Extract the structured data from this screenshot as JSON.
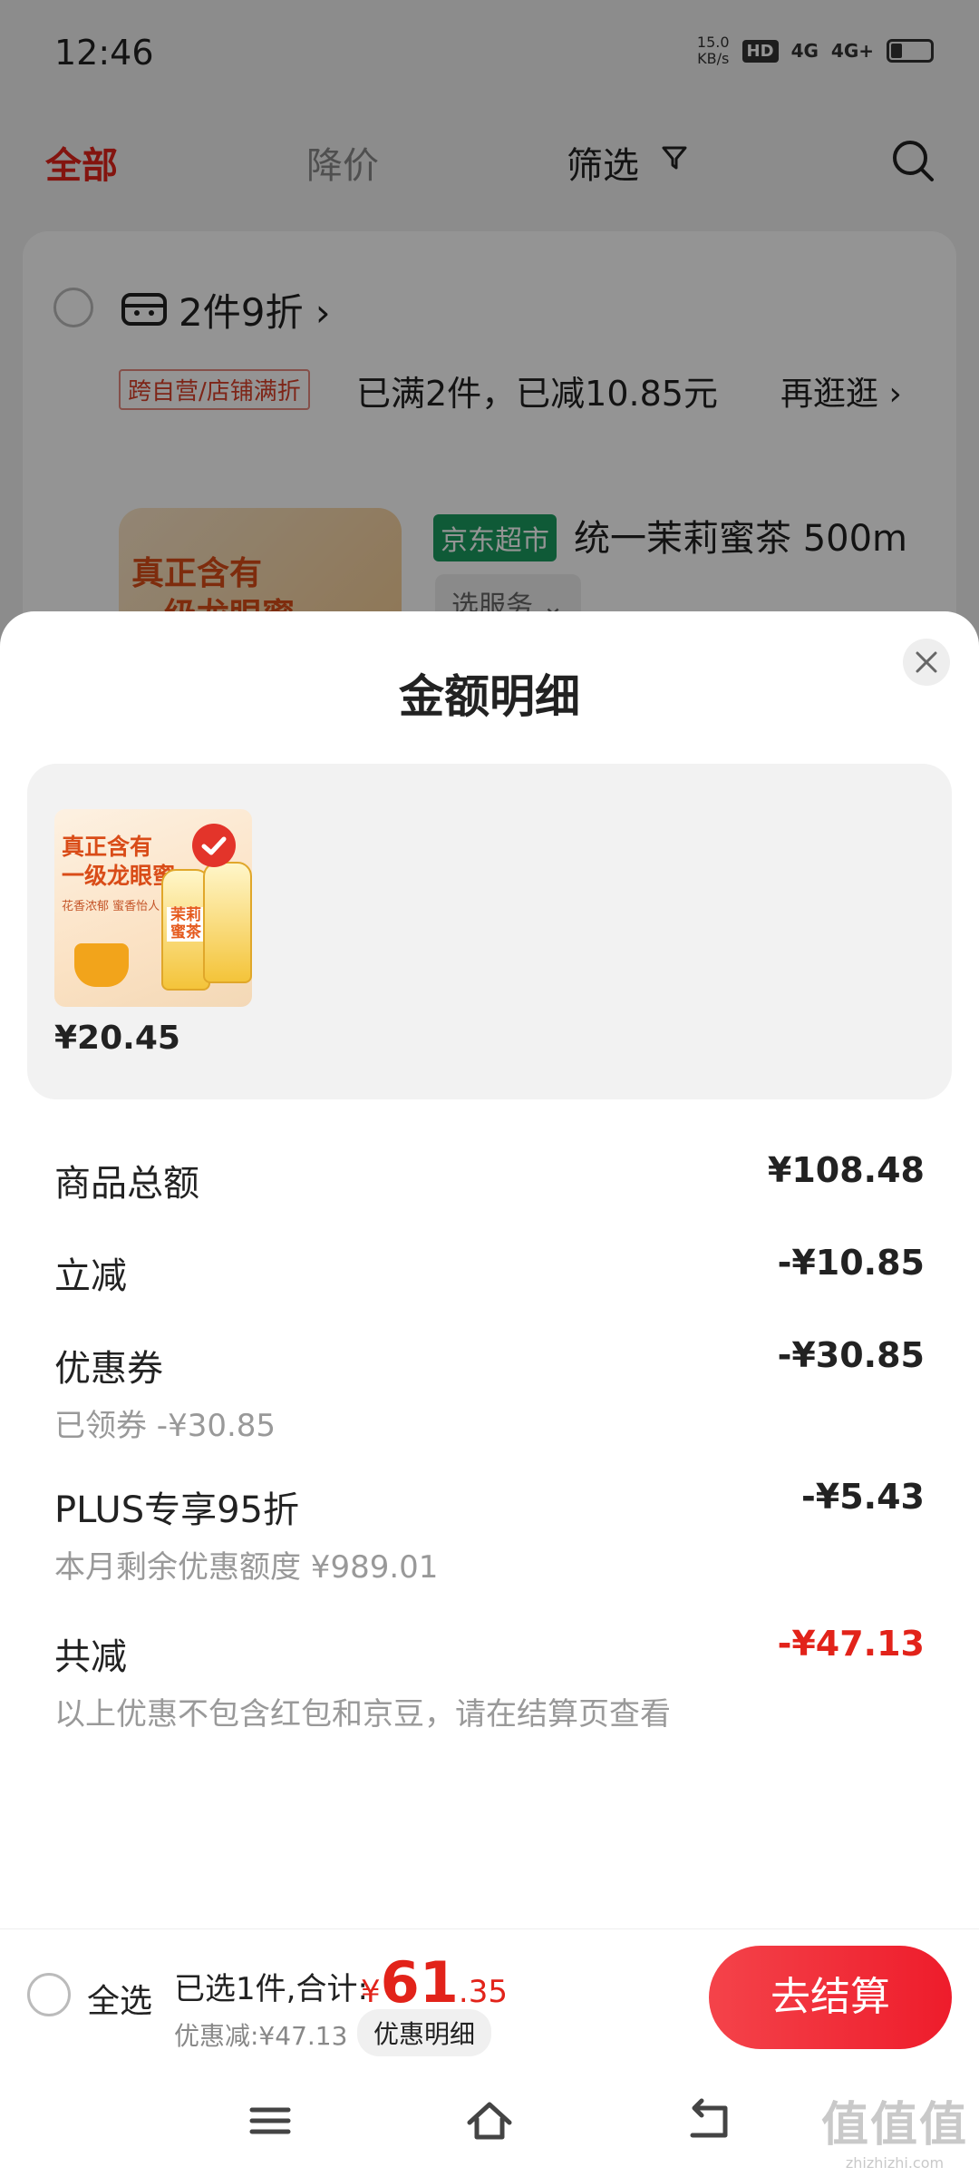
{
  "status_bar": {
    "time": "12:46",
    "net_speed_value": "15.0",
    "net_speed_unit": "KB/s",
    "hd": "HD",
    "net1": "4G",
    "net2": "4G+"
  },
  "tabs": {
    "all": "全部",
    "price_drop": "降价",
    "filter": "筛选"
  },
  "shop_card": {
    "promo_title": "2件9折",
    "promo_tag": "跨自营/店铺满折",
    "promo_text": "已满2件，已减10.85元",
    "more_link": "再逛逛 ›",
    "product_tag": "京东超市",
    "product_name": "统一茉莉蜜茶 500m",
    "service_chip": "选服务 ⌄",
    "thumb_text": "真正含有\n一级龙眼蜜"
  },
  "sheet": {
    "title": "金额明细",
    "item": {
      "image_text_1": "真正含有",
      "image_text_2": "一级龙眼蜜",
      "image_sub": "花香浓郁 蜜香怡人",
      "bottle_label": "茉莉蜜茶",
      "price": "¥20.45"
    },
    "rows": {
      "subtotal_label": "商品总额",
      "subtotal_value": "¥108.48",
      "instant_label": "立减",
      "instant_value": "-¥10.85",
      "coupon_label": "优惠券",
      "coupon_value": "-¥30.85",
      "coupon_sub": "已领券 -¥30.85",
      "plus_label": "PLUS专享95折",
      "plus_value": "-¥5.43",
      "plus_sub": "本月剩余优惠额度 ¥989.01",
      "total_label": "共减",
      "total_value": "-¥47.13",
      "note": "以上优惠不包含红包和京豆，请在结算页查看"
    }
  },
  "footer": {
    "select_all": "全选",
    "selected_summary": "已选1件,合计:",
    "price_yen": "¥",
    "price_int": "61",
    "price_dec": ".35",
    "discount": "优惠减:¥47.13",
    "detail_chip": "优惠明细",
    "checkout": "去结算"
  },
  "watermark": {
    "big": "值值值",
    "small": "zhizhizhi.com"
  },
  "colors": {
    "accent_red": "#e2231a",
    "jd_green": "#1a9c5f",
    "sheet_panel": "#f2f2f2"
  }
}
